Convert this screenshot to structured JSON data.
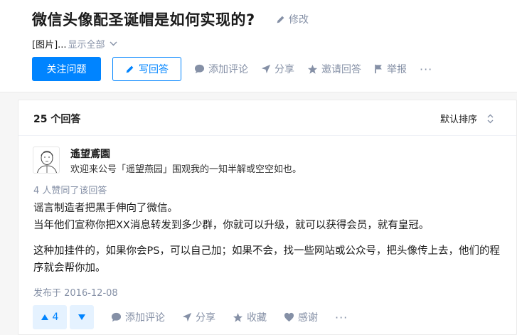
{
  "question": {
    "title": "微信头像配圣诞帽是如何实现的?",
    "edit_label": "修改",
    "detail_image": "[图片]...",
    "show_all_label": "显示全部",
    "follow_label": "关注问题",
    "write_answer_label": "写回答",
    "actions": [
      "添加评论",
      "分享",
      "邀请回答",
      "举报"
    ],
    "more_label": "···"
  },
  "answers_panel": {
    "count_label": "25 个回答",
    "sort_label": "默认排序"
  },
  "answer": {
    "author_name": "遙望鳶園",
    "author_bio": "欢迎来公号「遥望燕园」围观我的一知半解或空空如也。",
    "votes_note": "4 人赞同了该回答",
    "paragraph1_line1": "谣言制造者把黑手伸向了微信。",
    "paragraph1_line2": "当年他们宣称你把XX消息转发到多少群，你就可以升级，就可以获得会员，就有皇冠。",
    "paragraph2": "这种加挂件的，如果你会PS，可以自己加；如果不会，找一些网站或公众号，把头像传上去，他们的程序就会帮你加。",
    "published": "发布于 2016-12-08",
    "vote_count": "4",
    "actions": [
      "添加评论",
      "分享",
      "收藏",
      "感谢"
    ],
    "more_label": "···"
  },
  "colors": {
    "accent": "#0084ff",
    "muted": "#8590a6",
    "vote_bg": "#e5f2ff"
  }
}
